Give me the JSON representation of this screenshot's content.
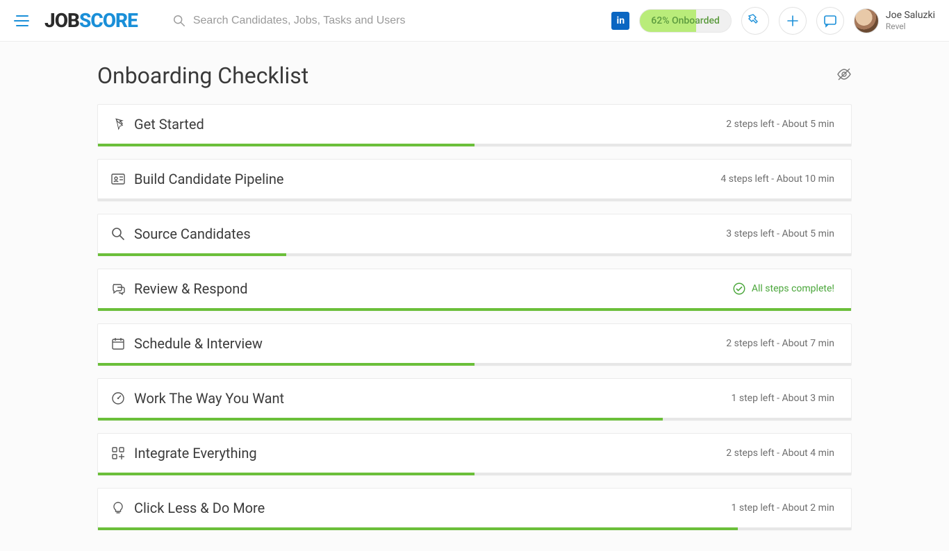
{
  "brand": {
    "part1": "JOB",
    "part2": "SCORE"
  },
  "search": {
    "placeholder": "Search Candidates, Jobs, Tasks and Users"
  },
  "linkedin_label": "in",
  "onboarded_badge": "62% Onboarded",
  "user": {
    "name": "Joe Saluzki",
    "company": "Revel"
  },
  "page": {
    "title": "Onboarding Checklist"
  },
  "checklist": [
    {
      "icon": "pointer-icon",
      "title": "Get Started",
      "status": "2 steps left - About 5 min",
      "complete": false,
      "progress": 50
    },
    {
      "icon": "id-card-icon",
      "title": "Build Candidate Pipeline",
      "status": "4 steps left - About 10 min",
      "complete": false,
      "progress": 0
    },
    {
      "icon": "search-icon",
      "title": "Source Candidates",
      "status": "3 steps left - About 5 min",
      "complete": false,
      "progress": 25
    },
    {
      "icon": "chat-icon",
      "title": "Review & Respond",
      "status": "All steps complete!",
      "complete": true,
      "progress": 100
    },
    {
      "icon": "calendar-icon",
      "title": "Schedule & Interview",
      "status": "2 steps left - About 7 min",
      "complete": false,
      "progress": 50
    },
    {
      "icon": "gauge-icon",
      "title": "Work The Way You Want",
      "status": "1 step left - About 3 min",
      "complete": false,
      "progress": 75
    },
    {
      "icon": "grid-icon",
      "title": "Integrate Everything",
      "status": "2 steps left - About 4 min",
      "complete": false,
      "progress": 50
    },
    {
      "icon": "bulb-icon",
      "title": "Click Less & Do More",
      "status": "1 step left - About 2 min",
      "complete": false,
      "progress": 85
    }
  ]
}
